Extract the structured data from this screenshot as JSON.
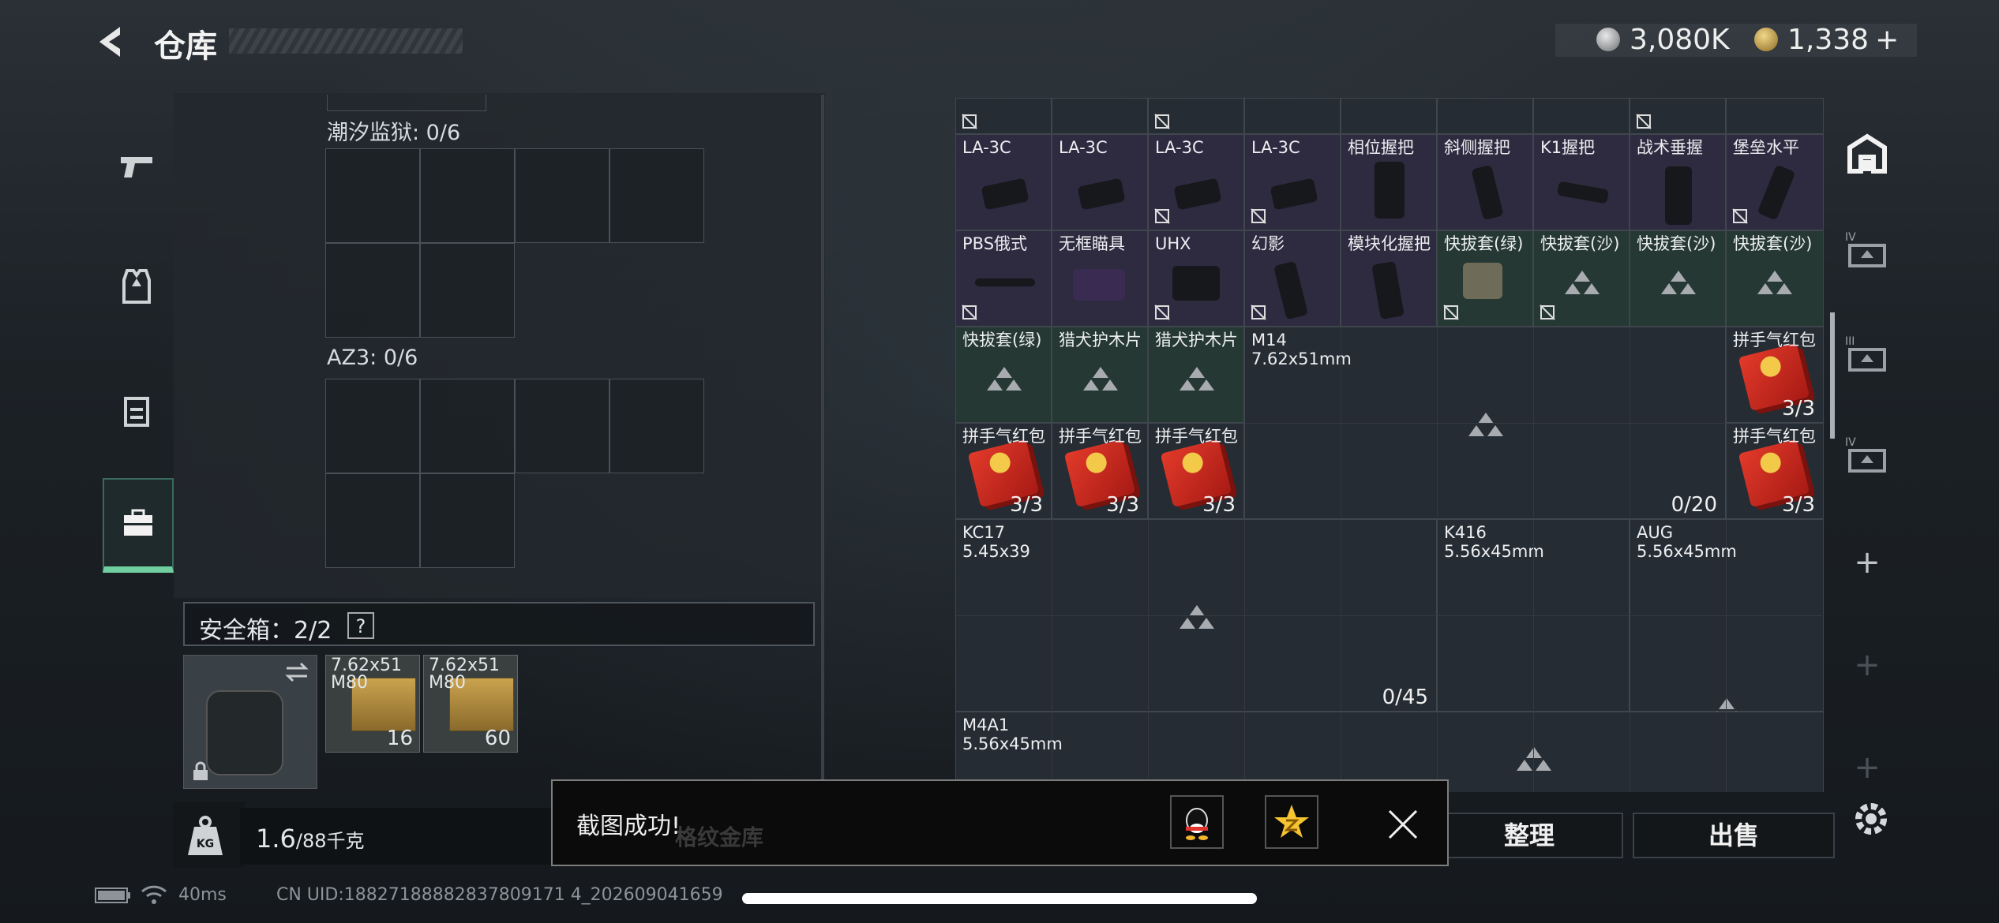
{
  "header": {
    "title": "仓库",
    "currency": [
      {
        "icon": "silver-coin-icon",
        "value": "3,080K"
      },
      {
        "icon": "gold-coin-icon",
        "value": "1,338",
        "plus": "+"
      }
    ]
  },
  "left_nav": [
    {
      "icon": "pistol-icon"
    },
    {
      "icon": "armor-vest-icon"
    },
    {
      "icon": "backpack-icon"
    },
    {
      "icon": "toolbox-icon",
      "active": true
    }
  ],
  "containers": [
    {
      "label": "潮汐监狱: 0/6"
    },
    {
      "label": "AZ3: 0/6"
    }
  ],
  "safe_box": {
    "label": "安全箱：2/2",
    "help": "?",
    "items": [
      {
        "name": "7.62x51 M80",
        "qty": "16"
      },
      {
        "name": "7.62x51 M80",
        "qty": "60"
      }
    ]
  },
  "weight": {
    "current": "1.6",
    "max": "/88千克"
  },
  "grid": {
    "row1": [
      {
        "name": "LA-3C"
      },
      {
        "name": "LA-3C"
      },
      {
        "name": "LA-3C"
      },
      {
        "name": "LA-3C"
      },
      {
        "name": "相位握把"
      },
      {
        "name": "斜侧握把"
      },
      {
        "name": "K1握把"
      },
      {
        "name": "战术垂握"
      },
      {
        "name": "堡垒水平"
      }
    ],
    "row2": [
      {
        "name": "PBS俄式"
      },
      {
        "name": "无框瞄具"
      },
      {
        "name": "UHX"
      },
      {
        "name": "幻影"
      },
      {
        "name": "模块化握把"
      },
      {
        "name": "快拔套(绿)"
      },
      {
        "name": "快拔套(沙)"
      },
      {
        "name": "快拔套(沙)"
      },
      {
        "name": "快拔套(沙)"
      }
    ],
    "row3": [
      {
        "name": "快拔套(绿)"
      },
      {
        "name": "猎犬护木片"
      },
      {
        "name": "猎犬护木片"
      }
    ],
    "m14": {
      "name": "M14",
      "caliber": "7.62x51mm"
    },
    "hongbao": [
      {
        "name": "拼手气红包",
        "qty": "3/3"
      },
      {
        "name": "拼手气红包",
        "qty": "3/3"
      },
      {
        "name": "拼手气红包",
        "qty": "3/3"
      },
      {
        "name": "拼手气红包",
        "qty": "3/3"
      },
      {
        "name": "拼手气红包",
        "qty": "3/3"
      }
    ],
    "m14_ammo": "0/20",
    "kc17": {
      "name": "KC17",
      "caliber": "5.45x39",
      "ammo": "0/45"
    },
    "k416": {
      "name": "K416",
      "caliber": "5.56x45mm"
    },
    "aug": {
      "name": "AUG",
      "caliber": "5.56x45mm"
    },
    "m4a1": {
      "name": "M4A1",
      "caliber": "5.56x45mm"
    }
  },
  "right_tabs": [
    {
      "icon": "safe-house-icon"
    },
    {
      "icon": "crate-iv-icon",
      "level": "IV"
    },
    {
      "icon": "crate-iii-icon",
      "level": "III"
    },
    {
      "icon": "crate-iv-icon",
      "level": "IV"
    },
    {
      "icon": "plus-icon",
      "label": "+"
    },
    {
      "icon": "plus-icon",
      "label": "+"
    },
    {
      "icon": "plus-icon",
      "label": "+"
    }
  ],
  "buttons": {
    "sort": "整理",
    "sell": "出售",
    "hidden_left": "格纹金库"
  },
  "toast": {
    "message": "截图成功!"
  },
  "status": {
    "ping": "40ms",
    "uid": "CN UID:18827188882837809171 4_202609041659"
  }
}
